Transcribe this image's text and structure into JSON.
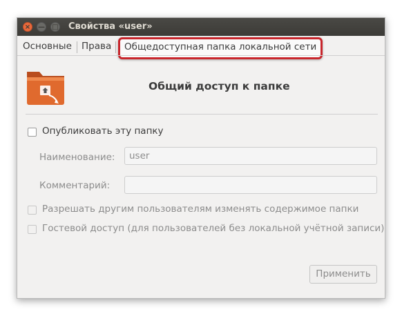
{
  "window": {
    "title": "Свойства «user»"
  },
  "titlebar_buttons": {
    "close": "×",
    "minimize": "—",
    "maximize": "□"
  },
  "tabs": [
    {
      "label": "Основные"
    },
    {
      "label": "Права"
    },
    {
      "label": "Общедоступная папка локальной сети",
      "active": true,
      "highlight_color": "#c8262c"
    }
  ],
  "share": {
    "heading": "Общий доступ к папке",
    "publish_label": "Опубликовать эту папку",
    "publish_checked": false,
    "name_label": "Наименование:",
    "name_value": "user",
    "comment_label": "Комментарий:",
    "comment_value": "",
    "allow_modify_label": "Разрешать другим пользователям изменять содержимое папки",
    "guest_label": "Гостевой доступ (для пользователей без локальной учётной записи)",
    "apply_label": "Применить"
  },
  "colors": {
    "titlebar": "#3c3b37",
    "accent_close": "#e9693b",
    "folder": "#e06a2e"
  }
}
